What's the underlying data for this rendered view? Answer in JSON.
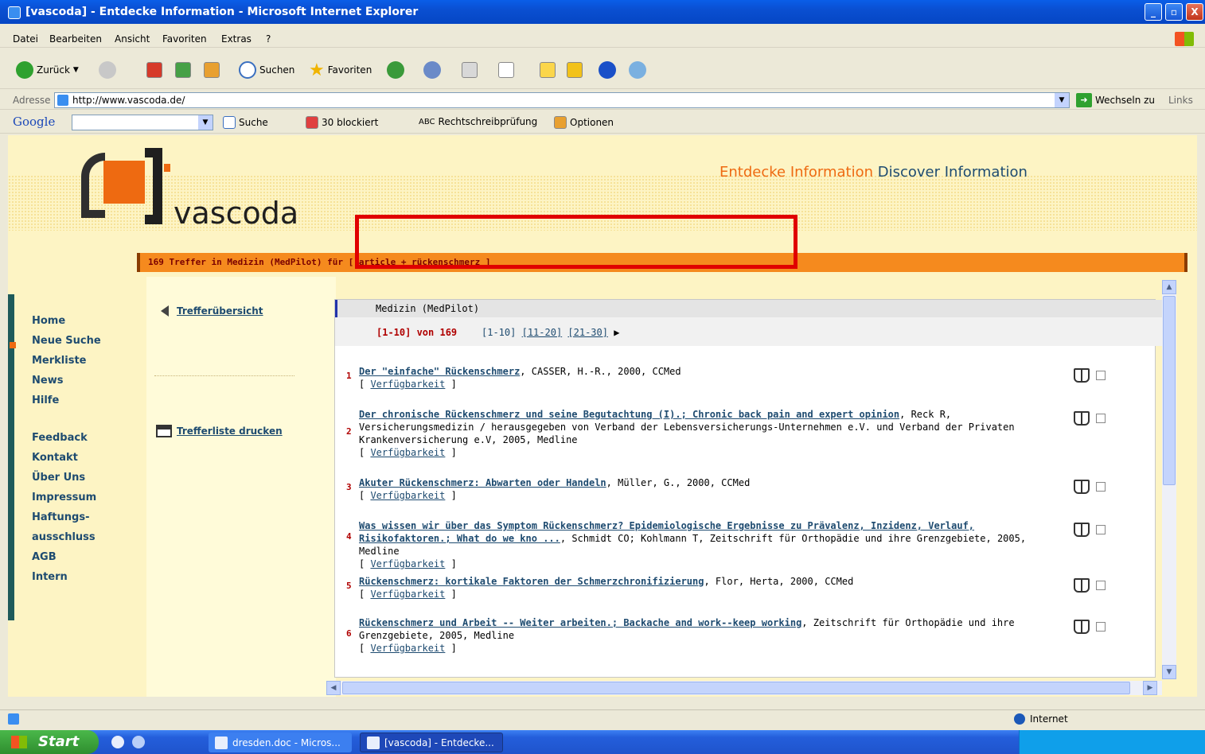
{
  "window": {
    "title": "[vascoda] - Entdecke Information - Microsoft Internet Explorer",
    "controls": [
      "_",
      "▫",
      "X"
    ]
  },
  "menu": [
    "Datei",
    "Bearbeiten",
    "Ansicht",
    "Favoriten",
    "Extras",
    "?"
  ],
  "toolbar": {
    "back": "Zurück",
    "search": "Suchen",
    "favorites": "Favoriten"
  },
  "address": {
    "label": "Adresse",
    "url": "http://www.vascoda.de/",
    "go": "Wechseln zu",
    "links": "Links"
  },
  "googlebar": {
    "logo": "Google",
    "search": "Suche",
    "blocked": "30 blockiert",
    "spell": "Rechtschreibprüfung",
    "options": "Optionen"
  },
  "site": {
    "logo_text": "vascoda",
    "tagline_orange": "Entdecke Information",
    "tagline_dark": "Discover Information",
    "hits_bar": "169 Treffer in Medizin (MedPilot) für [ article + rückenschmerz ]"
  },
  "nav": {
    "group1": [
      "Home",
      "Neue Suche",
      "Merkliste",
      "News",
      "Hilfe"
    ],
    "group2": [
      "Feedback",
      "Kontakt",
      "Über Uns",
      "Impressum",
      "Haftungs-",
      "ausschluss",
      "AGB",
      "Intern"
    ]
  },
  "midcol": {
    "back_link": "Trefferübersicht",
    "print_link": "Trefferliste drucken"
  },
  "results": {
    "header": "Medizin (MedPilot)",
    "current_range": "[1-10] von 169",
    "pages": [
      "[1-10]",
      "[11-20]",
      "[21-30]"
    ],
    "availability_label": "Verfügbarkeit",
    "items": [
      {
        "num": "1",
        "title": "Der \"einfache\" Rückenschmerz",
        "meta": ", CASSER, H.-R., 2000, CCMed"
      },
      {
        "num": "2",
        "title": "Der chronische Rückenschmerz und seine Begutachtung (I).; Chronic back pain and expert opinion",
        "meta": ", Reck R, Versicherungsmedizin / herausgegeben von Verband der Lebensversicherungs-Unternehmen e.V. und Verband der Privaten Krankenversicherung e.V, 2005, Medline"
      },
      {
        "num": "3",
        "title": "Akuter Rückenschmerz: Abwarten oder Handeln",
        "meta": ", Müller, G., 2000, CCMed"
      },
      {
        "num": "4",
        "title": "Was wissen wir über das Symptom Rückenschmerz? Epidemiologische Ergebnisse zu Prävalenz, Inzidenz, Verlauf, Risikofaktoren.; What do we kno ...",
        "meta": ", Schmidt CO; Kohlmann T, Zeitschrift für Orthopädie und ihre Grenzgebiete, 2005, Medline"
      },
      {
        "num": "5",
        "title": "Rückenschmerz: kortikale Faktoren der Schmerzchronifizierung",
        "meta": ", Flor, Herta, 2000, CCMed"
      },
      {
        "num": "6",
        "title": "Rückenschmerz und Arbeit -- Weiter arbeiten.; Backache and work--keep working",
        "meta": ", Zeitschrift für Orthopädie und ihre Grenzgebiete, 2005, Medline"
      }
    ]
  },
  "status": {
    "zone": "Internet"
  },
  "taskbar": {
    "start": "Start",
    "tasks": [
      "dresden.doc - Micros...",
      "[vascoda] - Entdecke..."
    ]
  },
  "colors": {
    "accent_orange": "#ee6a11",
    "link_blue": "#1e4b70",
    "number_red": "#b00000",
    "highlight_red": "#e00000"
  }
}
